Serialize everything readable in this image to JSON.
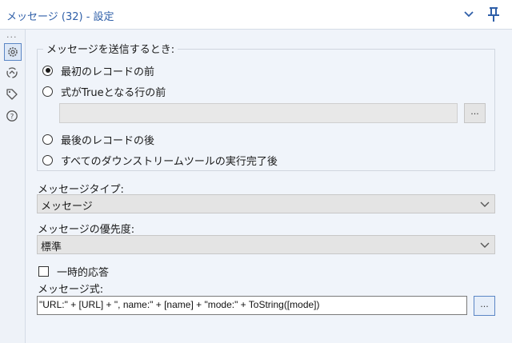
{
  "window": {
    "title": "メッセージ (32) - 設定"
  },
  "sidebar": {
    "overflow_dots": "...",
    "items": [
      {
        "icon": "gear-icon",
        "active": true
      },
      {
        "icon": "connection-icon",
        "active": false
      },
      {
        "icon": "tag-icon",
        "active": false
      },
      {
        "icon": "help-icon",
        "active": false
      }
    ]
  },
  "send_when": {
    "legend": "メッセージを送信するとき:",
    "options": [
      {
        "label": "最初のレコードの前",
        "checked": true
      },
      {
        "label": "式がTrueとなる行の前",
        "checked": false
      },
      {
        "label": "最後のレコードの後",
        "checked": false
      },
      {
        "label": "すべてのダウンストリームツールの実行完了後",
        "checked": false
      }
    ],
    "condition_value": "",
    "ellipsis_label": "..."
  },
  "message_type": {
    "label": "メッセージタイプ:",
    "value": "メッセージ"
  },
  "priority": {
    "label": "メッセージの優先度:",
    "value": "標準"
  },
  "transient": {
    "label": "一時的応答",
    "checked": false
  },
  "expression": {
    "label": "メッセージ式:",
    "value": "\"URL:\" + [URL] + \", name:\" + [name] + \"mode:\" + ToString([mode])",
    "ellipsis_label": "..."
  },
  "colors": {
    "title": "#2f5fa8",
    "accent_border": "#5b86c5",
    "panel_bg": "#f0f4fa"
  }
}
